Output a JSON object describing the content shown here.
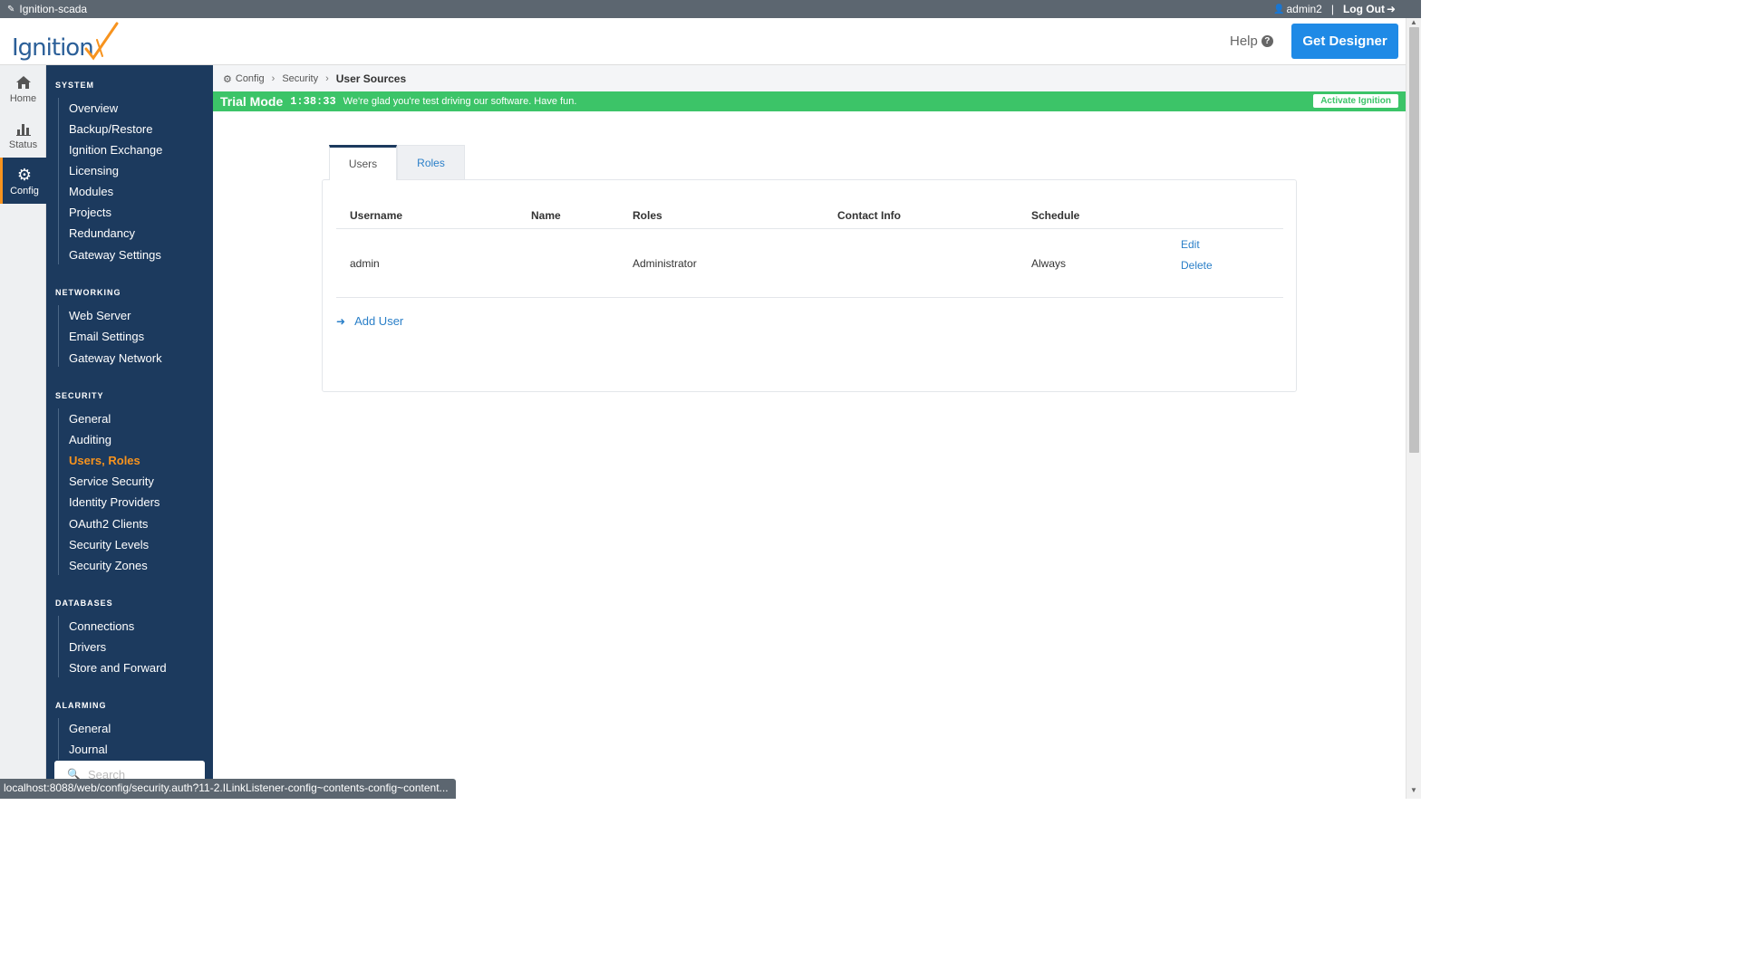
{
  "topbar": {
    "app_name": "Ignition-scada",
    "user": "admin2",
    "separator": "|",
    "logout": "Log Out"
  },
  "header": {
    "logo_text": "Ignition",
    "help": "Help",
    "get_designer": "Get Designer"
  },
  "rail": [
    {
      "label": "Home",
      "icon": "home-icon"
    },
    {
      "label": "Status",
      "icon": "bar-chart-icon"
    },
    {
      "label": "Config",
      "icon": "gear-icon",
      "active": true
    }
  ],
  "sidebar": {
    "sections": [
      {
        "title": "SYSTEM",
        "items": [
          "Overview",
          "Backup/Restore",
          "Ignition Exchange",
          "Licensing",
          "Modules",
          "Projects",
          "Redundancy",
          "Gateway Settings"
        ]
      },
      {
        "title": "NETWORKING",
        "items": [
          "Web Server",
          "Email Settings",
          "Gateway Network"
        ]
      },
      {
        "title": "SECURITY",
        "items": [
          "General",
          "Auditing",
          "Users, Roles",
          "Service Security",
          "Identity Providers",
          "OAuth2 Clients",
          "Security Levels",
          "Security Zones"
        ]
      },
      {
        "title": "DATABASES",
        "items": [
          "Connections",
          "Drivers",
          "Store and Forward"
        ]
      },
      {
        "title": "ALARMING",
        "items": [
          "General",
          "Journal"
        ]
      }
    ],
    "active_item": "Users, Roles",
    "search_placeholder": "Search"
  },
  "breadcrumb": {
    "items": [
      "Config",
      "Security"
    ],
    "current": "User Sources"
  },
  "trial": {
    "label": "Trial Mode",
    "time": "1:38:33",
    "message": "We're glad you're test driving our software. Have fun.",
    "activate": "Activate Ignition"
  },
  "tabs": [
    {
      "label": "Users",
      "active": true
    },
    {
      "label": "Roles",
      "active": false
    }
  ],
  "table": {
    "columns": [
      "Username",
      "Name",
      "Roles",
      "Contact Info",
      "Schedule"
    ],
    "rows": [
      {
        "username": "admin",
        "name": "",
        "roles": "Administrator",
        "contact": "",
        "schedule": "Always",
        "actions": [
          "Edit",
          "Delete"
        ]
      }
    ],
    "add_label": "Add User"
  },
  "status_url": "localhost:8088/web/config/security.auth?11-2.ILinkListener-config~contents-config~content...",
  "colors": {
    "sidebar_bg": "#1c3a5e",
    "accent_orange": "#f7931e",
    "primary_blue": "#1f8ae6",
    "link_blue": "#2a7fc8",
    "trial_green": "#3cc468",
    "topbar_bg": "#5c6670"
  }
}
